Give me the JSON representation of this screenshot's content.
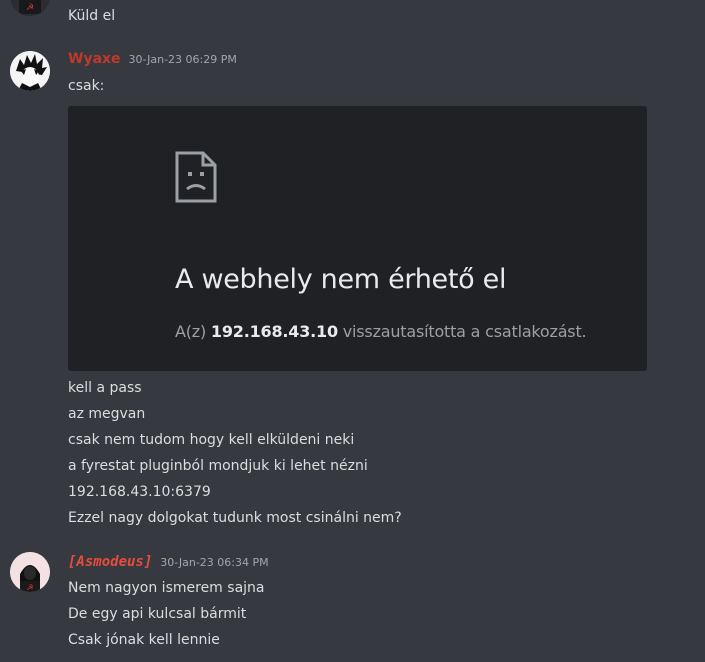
{
  "messages": {
    "prev": {
      "text": "Küld el"
    },
    "wyaxe": {
      "username": "Wyaxe",
      "username_color": "#c0392b",
      "timestamp": "30-Jan-23 06:29 PM",
      "first_line": "csak:",
      "embed": {
        "icon": "sad-document-icon",
        "title": "A webhely nem érhető el",
        "body_prefix": "A(z) ",
        "body_ip": "192.168.43.10",
        "body_suffix": " visszautasította a csatlakozást."
      },
      "lines": [
        "kell a pass",
        "az megvan",
        "csak nem tudom hogy kell elküldeni neki",
        "a fyrestat pluginból mondjuk ki lehet nézni",
        "192.168.43.10:6379",
        "Ezzel nagy dolgokat tudunk most csinálni nem?"
      ]
    },
    "asmodeus": {
      "username": "[⁣Asmodeus⁣]",
      "username_color": "#e74c3c",
      "timestamp": "30-Jan-23 06:34 PM",
      "lines": [
        "Nem nagyon ismerem sajna",
        "De egy api kulcsal bármit",
        "Csak jónak kell lennie"
      ]
    }
  }
}
